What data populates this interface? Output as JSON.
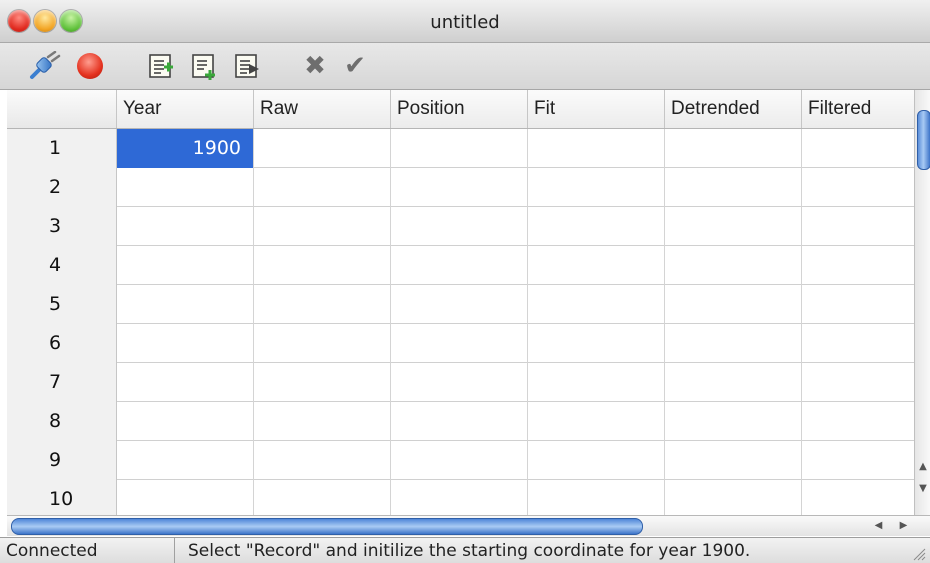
{
  "window": {
    "title": "untitled"
  },
  "toolbar": {
    "icons": [
      "connect-icon",
      "record-icon",
      "add-row-icon",
      "insert-row-icon",
      "delete-row-icon",
      "cancel-icon",
      "accept-icon"
    ],
    "colors": {
      "record": "#e4321f",
      "connect": "#3b7fd0",
      "doc_plus": "#3aa83a",
      "glyph": "#6e6e6e"
    }
  },
  "table": {
    "columns": [
      "Year",
      "Raw",
      "Position",
      "Fit",
      "Detrended",
      "Filtered"
    ],
    "row_numbers": [
      "1",
      "2",
      "3",
      "4",
      "5",
      "6",
      "7",
      "8",
      "9",
      "10"
    ],
    "rows": [
      [
        "1900",
        "",
        "",
        "",
        "",
        ""
      ],
      [
        "",
        "",
        "",
        "",
        "",
        ""
      ],
      [
        "",
        "",
        "",
        "",
        "",
        ""
      ],
      [
        "",
        "",
        "",
        "",
        "",
        ""
      ],
      [
        "",
        "",
        "",
        "",
        "",
        ""
      ],
      [
        "",
        "",
        "",
        "",
        "",
        ""
      ],
      [
        "",
        "",
        "",
        "",
        "",
        ""
      ],
      [
        "",
        "",
        "",
        "",
        "",
        ""
      ],
      [
        "",
        "",
        "",
        "",
        "",
        ""
      ],
      [
        "",
        "",
        "",
        "",
        "",
        ""
      ]
    ],
    "selected_cell": "1900",
    "selection_color": "#2e69d6"
  },
  "status": {
    "connection": "Connected",
    "message": "Select \"Record\" and initilize the starting coordinate for year 1900."
  }
}
